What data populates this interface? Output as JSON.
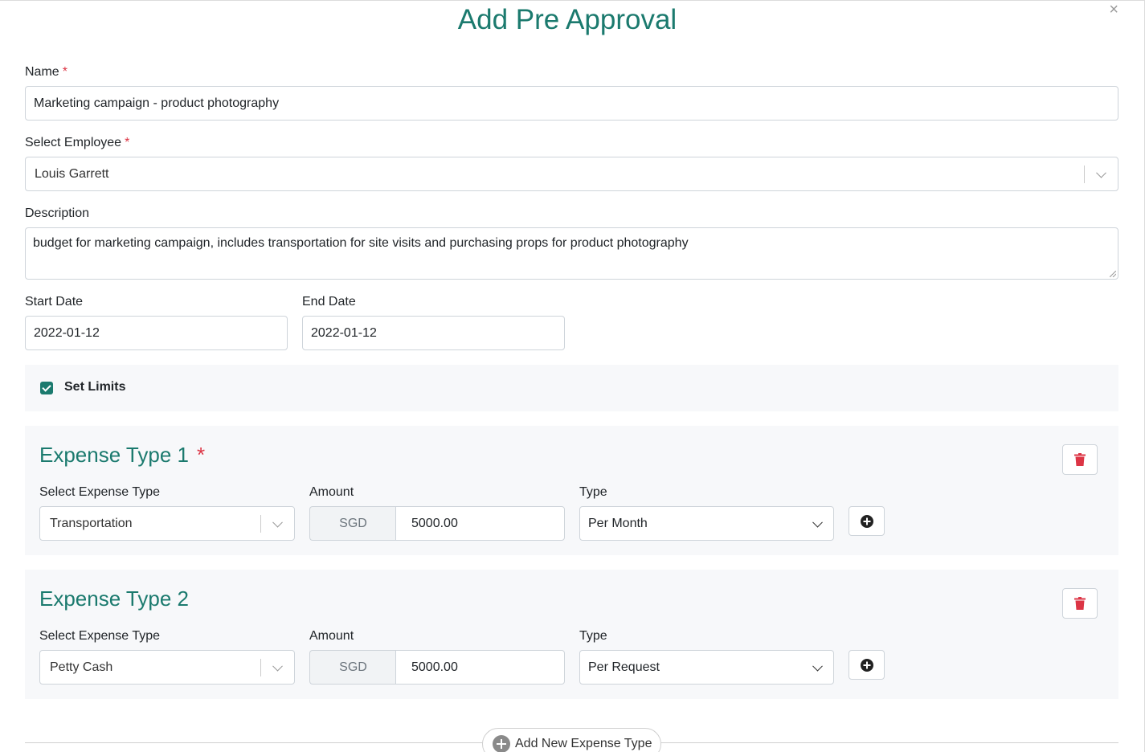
{
  "modal": {
    "title": "Add Pre Approval",
    "close_icon": "×"
  },
  "form": {
    "name": {
      "label": "Name",
      "required_mark": "*",
      "value": "Marketing campaign - product photography"
    },
    "employee": {
      "label": "Select Employee",
      "required_mark": "*",
      "value": "Louis Garrett"
    },
    "description": {
      "label": "Description",
      "value": "budget for marketing campaign, includes transportation for site visits and purchasing props for product photography"
    },
    "start_date": {
      "label": "Start Date",
      "value": "2022-01-12"
    },
    "end_date": {
      "label": "End Date",
      "value": "2022-01-12"
    },
    "set_limits": {
      "label": "Set Limits",
      "checked": true
    }
  },
  "expense_types": [
    {
      "title": "Expense Type 1",
      "required_mark": "*",
      "select_label": "Select Expense Type",
      "select_value": "Transportation",
      "amount_label": "Amount",
      "currency": "SGD",
      "amount": "5000.00",
      "type_label": "Type",
      "type_value": "Per Month"
    },
    {
      "title": "Expense Type 2",
      "required_mark": "",
      "select_label": "Select Expense Type",
      "select_value": "Petty Cash",
      "amount_label": "Amount",
      "currency": "SGD",
      "amount": "5000.00",
      "type_label": "Type",
      "type_value": "Per Request"
    }
  ],
  "actions": {
    "add_new_expense_type": "Add New Expense Type"
  },
  "colors": {
    "accent": "#1b7a6e",
    "danger": "#dc3545",
    "panel_bg": "#f7f8fa"
  },
  "icons": [
    "close-icon",
    "chevron-down-icon",
    "trash-icon",
    "plus-circle-icon",
    "checkmark-icon"
  ]
}
